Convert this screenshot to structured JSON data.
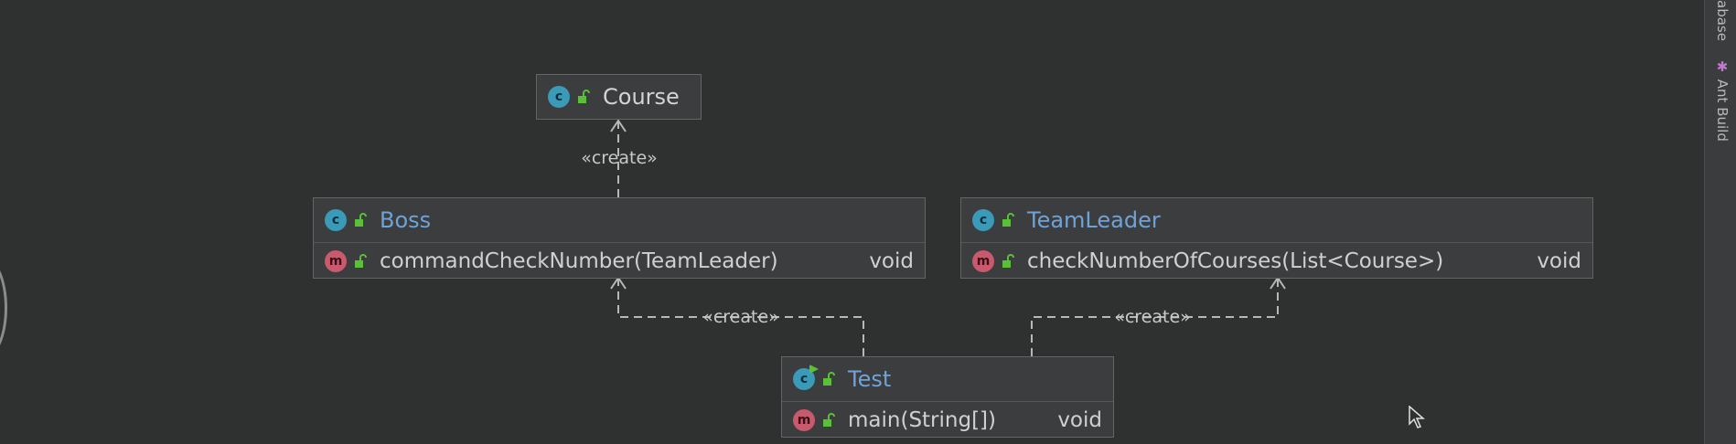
{
  "colors": {
    "background": "#2f3131",
    "node_fill": "#3b3d3e",
    "node_border": "#626466",
    "class_icon": "#3b9ab8",
    "method_icon": "#c9596c",
    "link_text": "#6fa3d8",
    "plain_text": "#d4d4d4",
    "edge": "#b8b8b8"
  },
  "nodes": {
    "course": {
      "icon": "class-icon",
      "title": "Course"
    },
    "boss": {
      "icon": "class-icon",
      "title": "Boss",
      "methods": [
        {
          "icon": "method-icon",
          "name": "commandCheckNumber(TeamLeader)",
          "type": "void"
        }
      ]
    },
    "teamleader": {
      "icon": "class-icon",
      "title": "TeamLeader",
      "methods": [
        {
          "icon": "method-icon",
          "name": "checkNumberOfCourses(List<Course>)",
          "type": "void"
        }
      ]
    },
    "test": {
      "icon": "class-icon",
      "title": "Test",
      "methods": [
        {
          "icon": "method-icon",
          "name": "main(String[])",
          "type": "void"
        }
      ]
    }
  },
  "edges": [
    {
      "from": "boss",
      "to": "course",
      "label": "«create»",
      "style": "dashed"
    },
    {
      "from": "test",
      "to": "boss",
      "label": "«create»",
      "style": "dashed"
    },
    {
      "from": "test",
      "to": "teamleader",
      "label": "«create»",
      "style": "dashed"
    }
  ],
  "side_panel": {
    "tabs": [
      "abase",
      "Ant Build"
    ]
  }
}
